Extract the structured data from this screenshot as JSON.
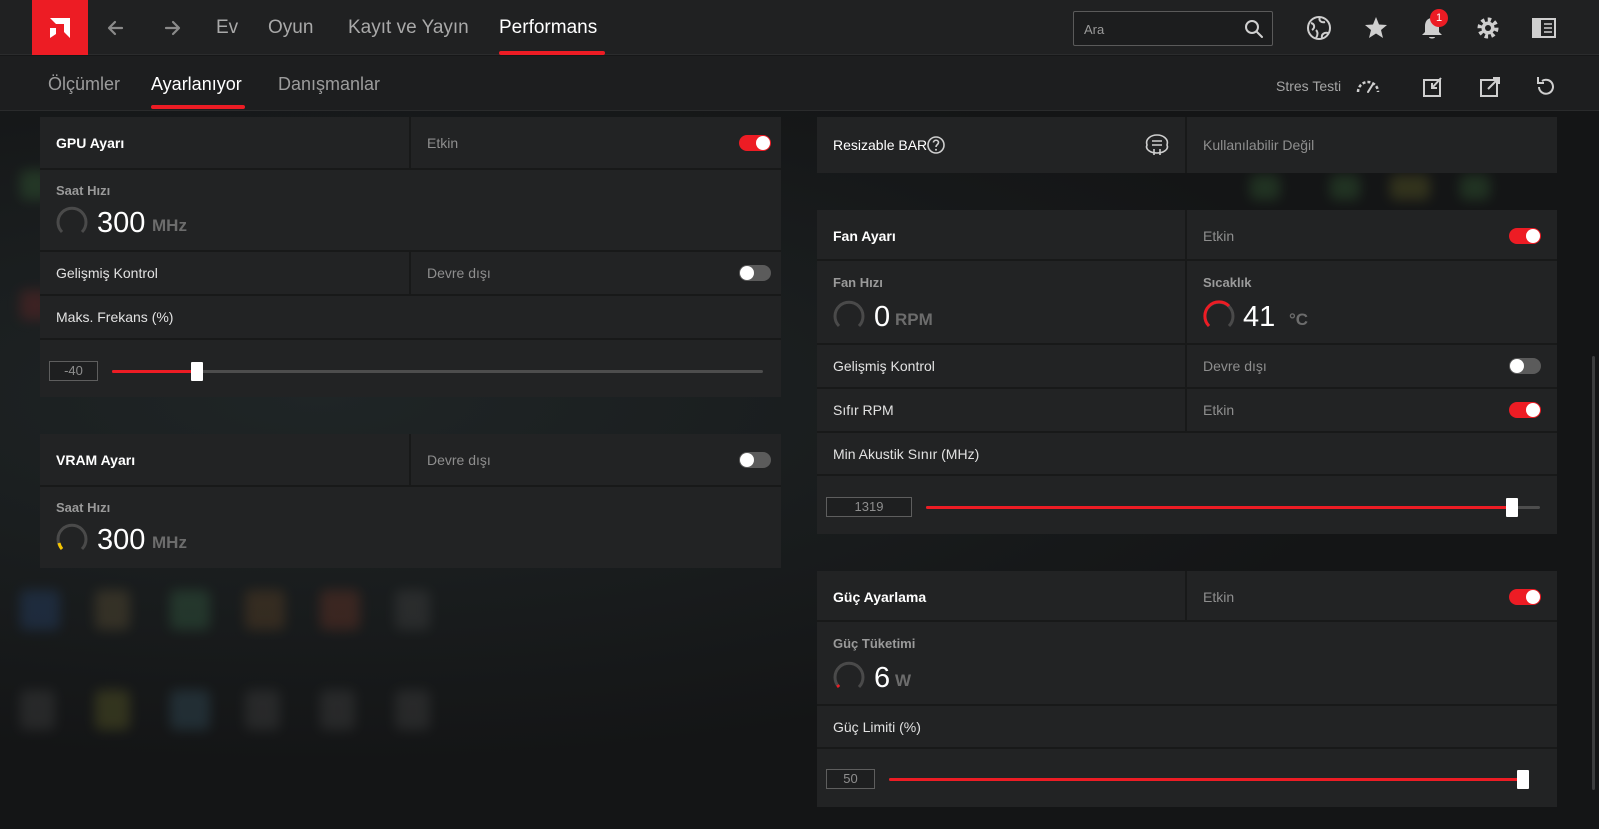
{
  "topnav": {
    "items": [
      {
        "label": "Ev"
      },
      {
        "label": "Oyun"
      },
      {
        "label": "Kayıt ve Yayın"
      },
      {
        "label": "Performans",
        "active": true
      }
    ],
    "search_placeholder": "Ara",
    "notification_count": "1",
    "icons": [
      "amd-logo-icon",
      "back-arrow-icon",
      "forward-arrow-icon",
      "search-icon",
      "globe-icon",
      "star-icon",
      "bell-icon",
      "gear-icon",
      "sidebar-panel-icon"
    ]
  },
  "subnav": {
    "items": [
      {
        "label": "Ölçümler"
      },
      {
        "label": "Ayarlanıyor",
        "active": true
      },
      {
        "label": "Danışmanlar"
      }
    ],
    "stress_test_label": "Stres Testi",
    "icons": [
      "gauge-icon",
      "import-icon",
      "export-icon",
      "reset-icon"
    ]
  },
  "gpu": {
    "title": "GPU Ayarı",
    "state": "Etkin",
    "enabled": true,
    "clock_title": "Saat Hızı",
    "clock_value": "300",
    "clock_unit": "MHz",
    "advanced_label": "Gelişmiş Kontrol",
    "advanced_state": "Devre dışı",
    "advanced_enabled": false,
    "max_freq_label": "Maks. Frekans (%)",
    "max_freq_value": "-40",
    "max_freq_fraction": 0.13
  },
  "vram": {
    "title": "VRAM Ayarı",
    "state": "Devre dışı",
    "enabled": false,
    "clock_title": "Saat Hızı",
    "clock_value": "300",
    "clock_unit": "MHz"
  },
  "rebar": {
    "title": "Resizable BAR",
    "state": "Kullanılabilir Değil",
    "icons": [
      "help-icon",
      "chip-icon"
    ]
  },
  "fan": {
    "title": "Fan Ayarı",
    "state": "Etkin",
    "enabled": true,
    "speed_title": "Fan Hızı",
    "speed_value": "0",
    "speed_unit": "RPM",
    "temp_title": "Sıcaklık",
    "temp_value": "41",
    "temp_unit": "°C",
    "advanced_label": "Gelişmiş Kontrol",
    "advanced_state": "Devre dışı",
    "advanced_enabled": false,
    "zero_rpm_label": "Sıfır RPM",
    "zero_rpm_state": "Etkin",
    "zero_rpm_enabled": true,
    "acoustic_label": "Min Akustik Sınır (MHz)",
    "acoustic_value": "1319",
    "acoustic_fraction": 0.955
  },
  "power": {
    "title": "Güç Ayarlama",
    "state": "Etkin",
    "enabled": true,
    "consumption_title": "Güç Tüketimi",
    "consumption_value": "6",
    "consumption_unit": "W",
    "limit_label": "Güç Limiti (%)",
    "limit_value": "50",
    "limit_fraction": 1.0
  },
  "colors": {
    "accent": "#ed1c24",
    "panel": "#222324",
    "gauge_idle": "#4a4a4a",
    "gauge_warm": "#ed1c24",
    "gauge_yellow": "#f5c400"
  }
}
